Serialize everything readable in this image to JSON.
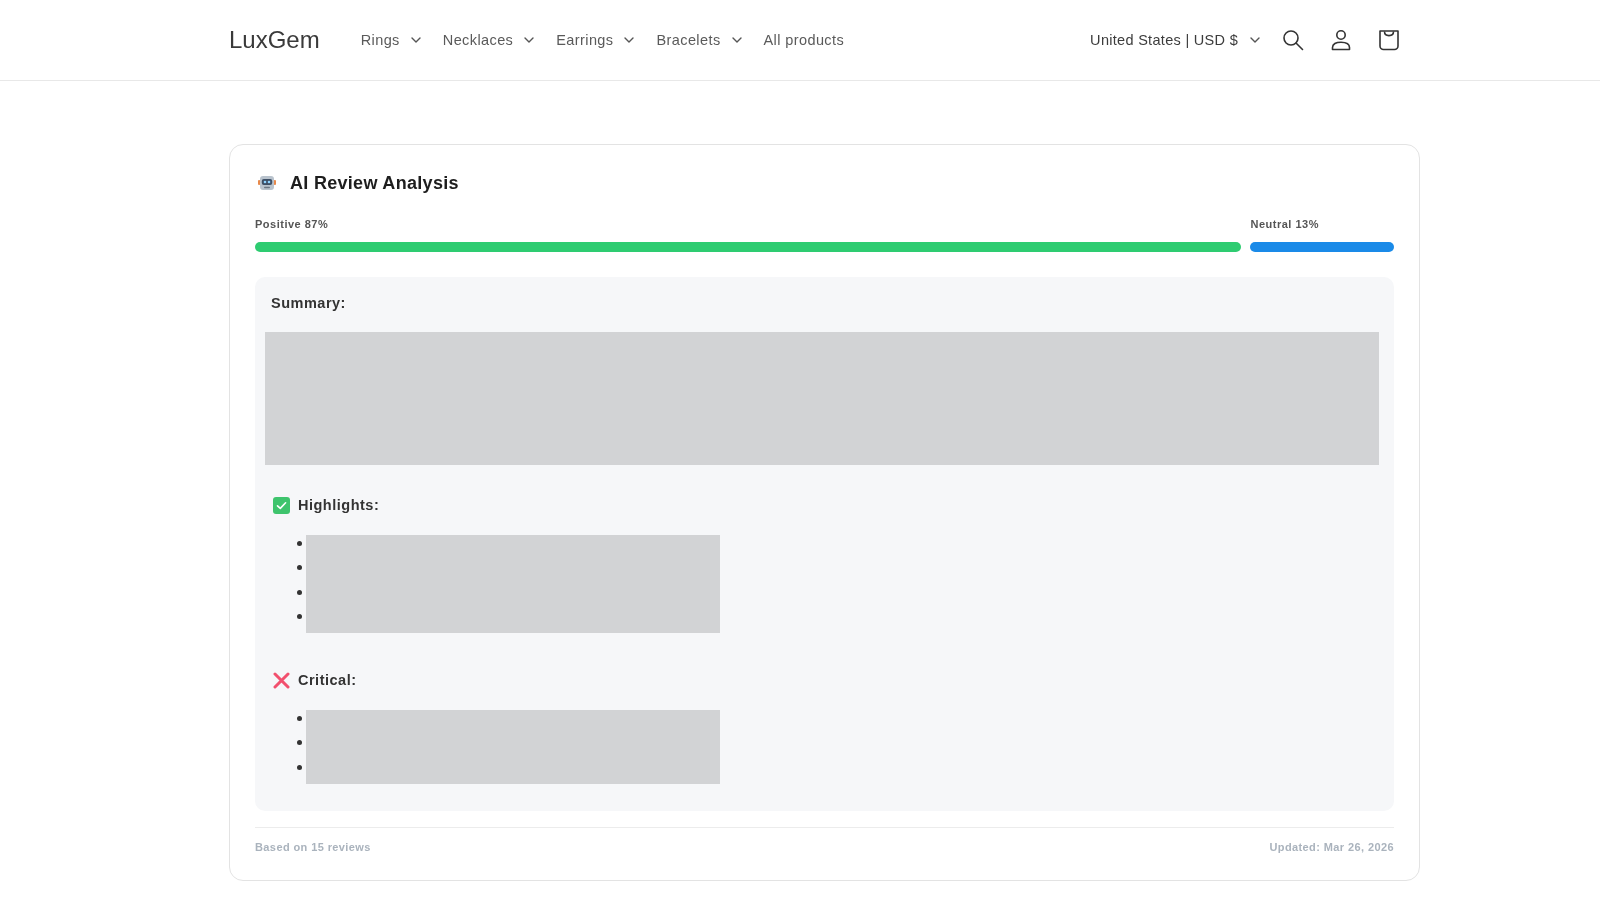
{
  "header": {
    "logo": "LuxGem",
    "nav": [
      {
        "label": "Rings",
        "has_menu": true
      },
      {
        "label": "Necklaces",
        "has_menu": true
      },
      {
        "label": "Earrings",
        "has_menu": true
      },
      {
        "label": "Bracelets",
        "has_menu": true
      },
      {
        "label": "All products",
        "has_menu": false
      }
    ],
    "locale": "United States | USD $"
  },
  "analysis": {
    "title": "AI Review Analysis",
    "sentiment": [
      {
        "label": "Positive 87%",
        "level": 0.87,
        "color": "#2ecc71"
      },
      {
        "label": "Neutral 13%",
        "level": 0.13,
        "color": "#1a8ae8"
      }
    ],
    "sections": [
      {
        "kind": "summary",
        "title": "Summary:",
        "content": {
          "kind": "redacted"
        }
      },
      {
        "kind": "highlights",
        "title": "Highlights:",
        "items": [
          {
            "kind": "redacted"
          },
          {
            "kind": "redacted"
          },
          {
            "kind": "redacted"
          },
          {
            "kind": "redacted"
          }
        ]
      },
      {
        "kind": "critical",
        "title": "Critical:",
        "items": [
          {
            "kind": "redacted"
          },
          {
            "kind": "redacted"
          },
          {
            "kind": "redacted"
          }
        ]
      }
    ],
    "footer": {
      "reviews": "Based on 15 reviews",
      "updated": "Updated: Mar 26, 2026"
    }
  }
}
